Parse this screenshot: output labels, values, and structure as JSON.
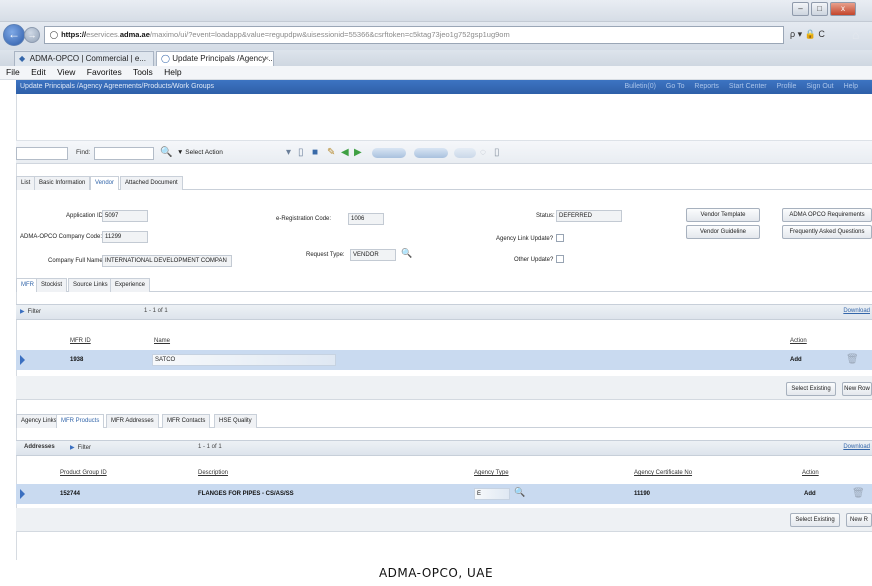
{
  "browser": {
    "window_controls": {
      "minimize": "–",
      "maximize": "□",
      "close": "x"
    },
    "url_scheme": "https://",
    "url_domain_prefix": "eservices.",
    "url_domain": "adma.ae",
    "url_path": "/maximo/ui/?event=loadapp&value=regupdpw&uisessionid=55366&csrftoken=c5ktag73jeo1g752gsp1ug9om",
    "url_tools": "ρ ▾ 🔒 C",
    "tabs": [
      {
        "label": "ADMA-OPCO | Commercial | e...",
        "close": ""
      },
      {
        "label": "Update Principals /Agency ...",
        "close": "×"
      }
    ],
    "menu": [
      "File",
      "Edit",
      "View",
      "Favorites",
      "Tools",
      "Help"
    ]
  },
  "app": {
    "title": "Update Principals /Agency Agreements/Products/Work Groups",
    "right_links": [
      "Bulletin(0)",
      "Go To",
      "Reports",
      "Start Center",
      "Profile",
      "Sign Out",
      "Help"
    ],
    "toolbar": {
      "find_label": "Find:",
      "select_action": "Select Action",
      "dropdown_marker": "▼"
    },
    "tabs": [
      "List",
      "Basic Information",
      "Vendor",
      "Attached Document"
    ],
    "active_tab": "Vendor",
    "form": {
      "application_id_label": "Application ID:",
      "application_id": "5097",
      "company_code_label": "ADMA-OPCO Company Code:",
      "company_code": "11299",
      "company_name_label": "Company Full Name:",
      "company_name": "INTERNATIONAL DEVELOPMENT COMPAN",
      "ereg_code_label": "e-Registration Code:",
      "ereg_code": "1006",
      "request_type_label": "Request Type:",
      "request_type": "VENDOR",
      "status_label": "Status:",
      "status": "DEFERRED",
      "agency_link_label": "Agency Link Update?",
      "other_update_label": "Other Update?",
      "buttons": [
        "Vendor Template",
        "Vendor Guideline",
        "ADMA OPCO Requirements",
        "Frequently Asked Questions"
      ]
    },
    "mfr_tabs": [
      "MFR",
      "Stockist",
      "Source Links",
      "Experience"
    ],
    "mfr_table": {
      "filter": "Filter",
      "pager": "1 - 1 of 1",
      "download": "Download",
      "columns": [
        "MFR ID",
        "Name",
        "Action"
      ],
      "rows": [
        {
          "id": "1938",
          "name": "SATCO",
          "action": "Add"
        }
      ],
      "buttons": [
        "Select Existing",
        "New Row"
      ]
    },
    "product_tabs": [
      "Agency Links",
      "MFR Products",
      "MFR Addresses",
      "MFR Contacts",
      "HSE Quality"
    ],
    "product_table": {
      "section": "Addresses",
      "filter": "Filter",
      "pager": "1 - 1 of 1",
      "download": "Download",
      "columns": [
        "Product Group ID",
        "Description",
        "Agency Type",
        "Agency Certificate No",
        "Action"
      ],
      "rows": [
        {
          "group_id": "152744",
          "description": "FLANGES FOR PIPES - CS/AS/SS",
          "agency_type": "E",
          "cert_no": "11190",
          "action": "Add"
        }
      ],
      "buttons": [
        "Select Existing",
        "New R"
      ]
    }
  },
  "caption": "ADMA-OPCO, UAE"
}
